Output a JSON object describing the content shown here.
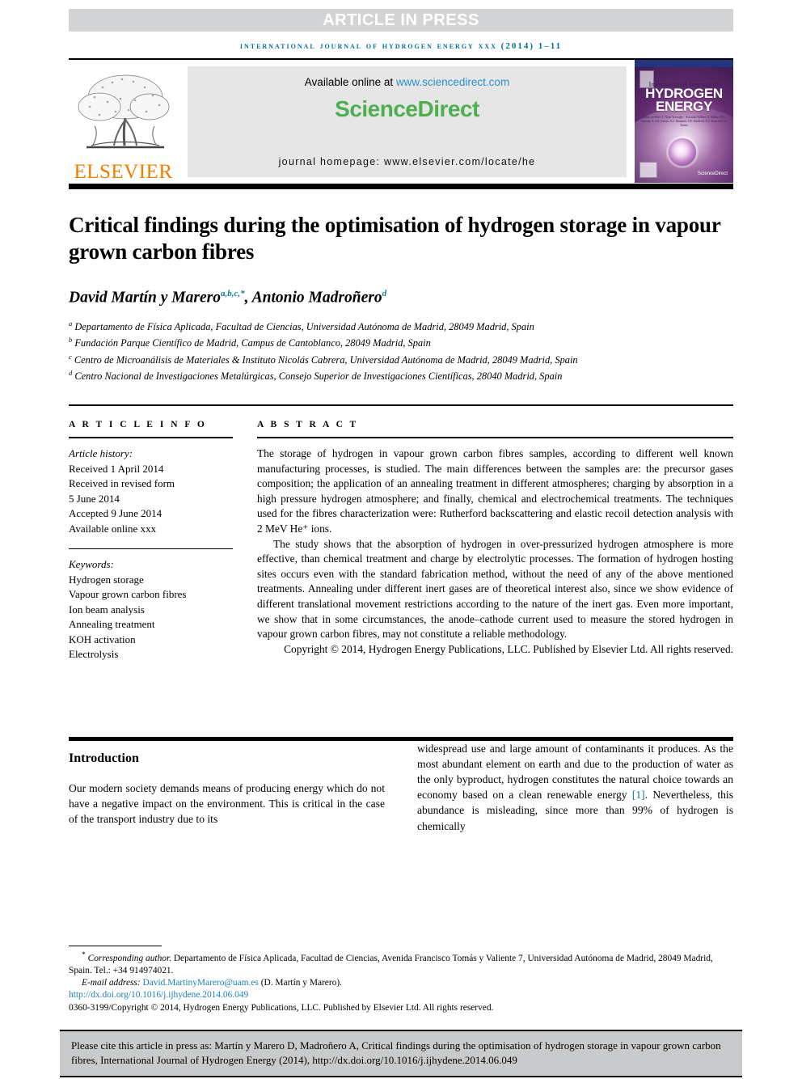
{
  "banner": {
    "article_in_press": "ARTICLE IN PRESS"
  },
  "running_head": "International Journal of Hydrogen Energy xxx (2014) 1–11",
  "masthead": {
    "publisher_name": "ELSEVIER",
    "available_prefix": "Available online at ",
    "available_url": "www.sciencedirect.com",
    "sciencedirect_logo": "ScienceDirect",
    "journal_homepage": "journal homepage: www.elsevier.com/locate/he",
    "cover": {
      "small_title": "International Journal of",
      "big_title_line1": "HYDROGEN",
      "big_title_line2": "ENERGY",
      "editors": "Editor-in-Chief: T. Nejat Veziroğlu · Associate Editors: A. Bilbao, D.C. Faustini, A. d.R. Garcia, A.L. Manakin, J.W. Sheffield, E.L. Kost and J.A. Turner",
      "sciencedirect_mark": "ScienceDirect"
    }
  },
  "article": {
    "title": "Critical findings during the optimisation of hydrogen storage in vapour grown carbon fibres",
    "authors": [
      {
        "name": "David Martín y Marero",
        "marks": "a,b,c,*"
      },
      {
        "name": "Antonio Madroñero",
        "marks": "d"
      }
    ],
    "author_separator": ", ",
    "affiliations": [
      {
        "mark": "a",
        "text": "Departamento de Física Aplicada, Facultad de Ciencias, Universidad Autónoma de Madrid, 28049 Madrid, Spain"
      },
      {
        "mark": "b",
        "text": "Fundación Parque Científico de Madrid, Campus de Cantoblanco, 28049 Madrid, Spain"
      },
      {
        "mark": "c",
        "text": "Centro de Microanálisis de Materiales & Instituto Nicolás Cabrera, Universidad Autónoma de Madrid, 28049 Madrid, Spain"
      },
      {
        "mark": "d",
        "text": "Centro Nacional de Investigaciones Metalúrgicas, Consejo Superior de Investigaciones Científicas, 28040 Madrid, Spain"
      }
    ]
  },
  "article_info": {
    "label": "A R T I C L E   I N F O",
    "history_label": "Article history:",
    "history": [
      "Received 1 April 2014",
      "Received in revised form",
      "5 June 2014",
      "Accepted 9 June 2014",
      "Available online xxx"
    ],
    "keywords_label": "Keywords:",
    "keywords": [
      "Hydrogen storage",
      "Vapour grown carbon fibres",
      "Ion beam analysis",
      "Annealing treatment",
      "KOH activation",
      "Electrolysis"
    ]
  },
  "abstract": {
    "label": "A B S T R A C T",
    "paragraphs": [
      "The storage of hydrogen in vapour grown carbon fibres samples, according to different well known manufacturing processes, is studied. The main differences between the samples are: the precursor gases composition; the application of an annealing treatment in different atmospheres; charging by absorption in a high pressure hydrogen atmosphere; and finally, chemical and electrochemical treatments. The techniques used for the fibres characterization were: Rutherford backscattering and elastic recoil detection analysis with 2 MeV He⁺ ions.",
      "The study shows that the absorption of hydrogen in over-pressurized hydrogen atmosphere is more effective, than chemical treatment and charge by electrolytic processes. The formation of hydrogen hosting sites occurs even with the standard fabrication method, without the need of any of the above mentioned treatments. Annealing under different inert gases are of theoretical interest also, since we show evidence of different translational movement restrictions according to the nature of the inert gas. Even more important, we show that in some circumstances, the anode–cathode current used to measure the stored hydrogen in vapour grown carbon fibres, may not constitute a reliable methodology."
    ],
    "copyright": "Copyright © 2014, Hydrogen Energy Publications, LLC. Published by Elsevier Ltd. All rights reserved."
  },
  "body": {
    "section_heading": "Introduction",
    "left_paragraph": "Our modern society demands means of producing energy which do not have a negative impact on the environment. This is critical in the case of the transport industry due to its",
    "right_paragraph_part1": "widespread use and large amount of contaminants it produces. As the most abundant element on earth and due to the production of water as the only byproduct, hydrogen constitutes the natural choice towards an economy based on a clean renewable energy ",
    "right_reference": "[1]",
    "right_paragraph_part2": ". Nevertheless, this abundance is misleading, since more than 99% of hydrogen is chemically"
  },
  "footnote": {
    "corresponding_marker": "*",
    "corresponding_label": "Corresponding author.",
    "corresponding_text": " Departamento de Física Aplicada, Facultad de Ciencias, Avenida Francisco Tomás y Valiente 7, Universidad Autónoma de Madrid, 28049 Madrid, Spain. Tel.: +34 914974021.",
    "email_label": "E-mail address: ",
    "email": "David.MartinyMarero@uam.es",
    "email_suffix": " (D. Martín y Marero).",
    "doi": "http://dx.doi.org/10.1016/j.ijhydene.2014.06.049",
    "issn_line": "0360-3199/Copyright © 2014, Hydrogen Energy Publications, LLC. Published by Elsevier Ltd. All rights reserved."
  },
  "cite_box": {
    "text": "Please cite this article in press as: Martín y Marero D, Madroñero A, Critical findings during the optimisation of hydrogen storage in vapour grown carbon fibres, International Journal of Hydrogen Energy (2014), http://dx.doi.org/10.1016/j.ijhydene.2014.06.049"
  },
  "colors": {
    "accent_blue": "#0f76a8",
    "link_blue": "#1c7fb5",
    "elsevier_orange": "#f07d00",
    "sciencedirect_green": "#4daf4e",
    "banner_gray": "#d2d3d5",
    "cite_box_gray": "#c9cacb"
  }
}
